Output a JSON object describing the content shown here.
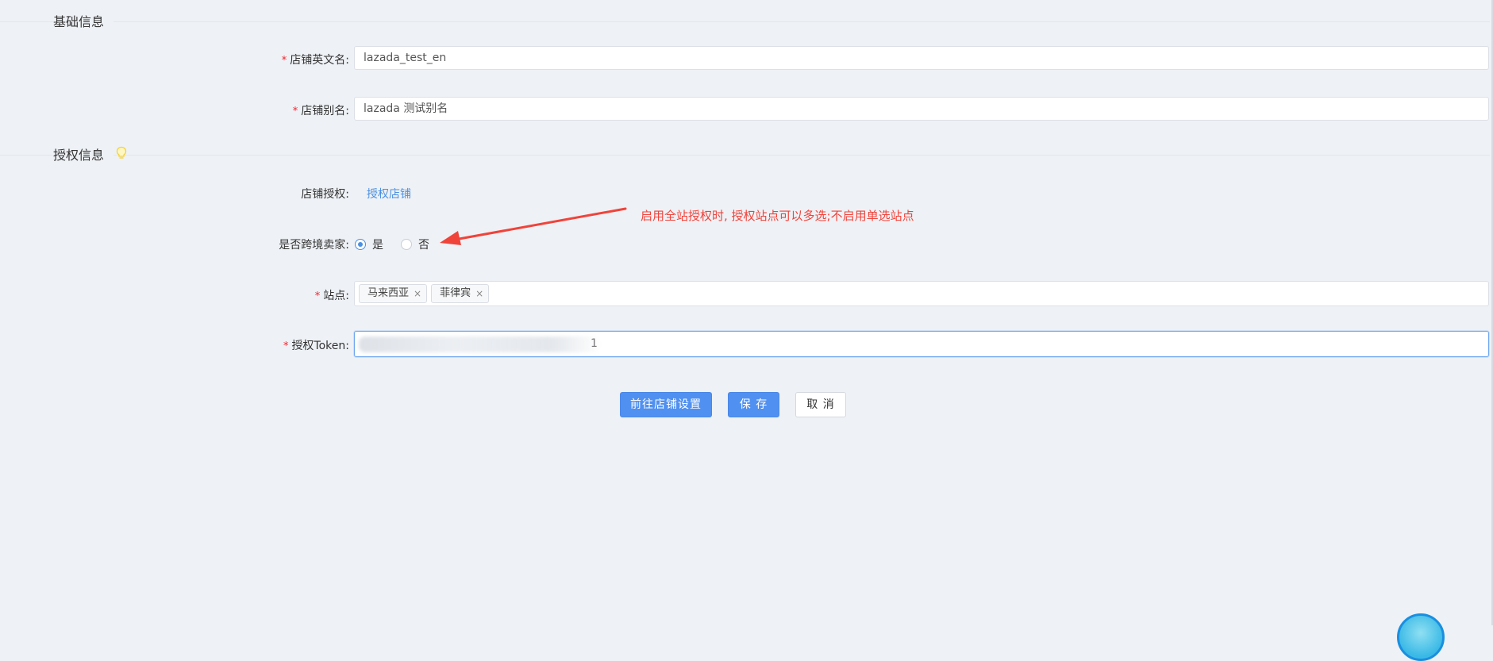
{
  "sections": {
    "basic_title": "基础信息",
    "auth_title": "授权信息"
  },
  "fields": {
    "store_en_name": {
      "required": "*",
      "label": "店铺英文名:",
      "value": "lazada_test_en"
    },
    "store_alias": {
      "required": "*",
      "label": "店铺别名:",
      "value": "lazada 测试别名"
    },
    "store_auth": {
      "label": "店铺授权:",
      "link": "授权店铺"
    },
    "cross_border": {
      "label": "是否跨境卖家:",
      "options": [
        {
          "label": "是",
          "checked": true
        },
        {
          "label": "否",
          "checked": false
        }
      ]
    },
    "sites": {
      "required": "*",
      "label": "站点:",
      "tags": [
        "马来西亚",
        "菲律宾"
      ],
      "tag_close": "×"
    },
    "auth_token": {
      "required": "*",
      "label": "授权Token:",
      "visible_tail": "1"
    }
  },
  "annotation": {
    "text": "启用全站授权时, 授权站点可以多选;不启用单选站点",
    "color": "#f0433a"
  },
  "buttons": {
    "go_store_settings": "前往店铺设置",
    "save": "保 存",
    "cancel": "取 消"
  },
  "colors": {
    "accent": "#5090f0",
    "link": "#4a90e2",
    "required": "#f5222d",
    "background": "#eef1f5"
  }
}
